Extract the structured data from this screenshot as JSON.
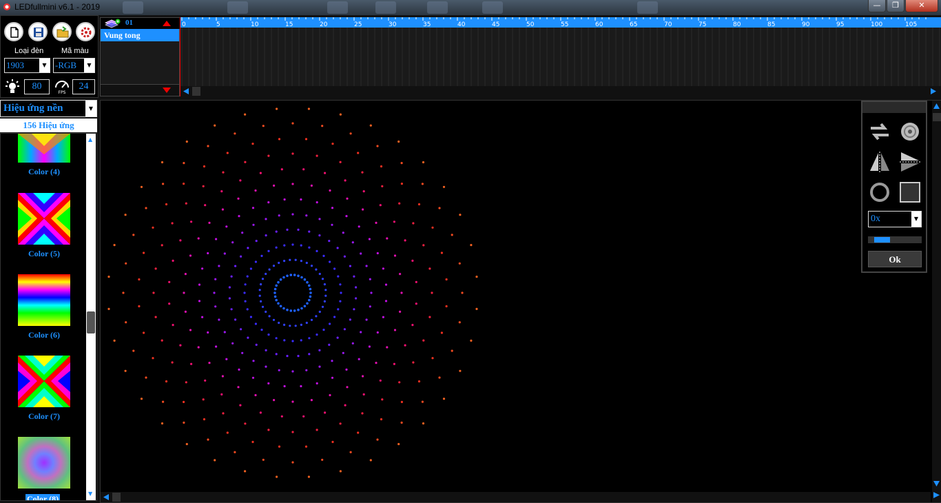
{
  "window": {
    "title": "LEDfullmini v6.1 - 2019",
    "min_glyph": "—",
    "max_glyph": "❐",
    "close_glyph": "✕"
  },
  "toolbar": {
    "buttons": [
      {
        "name": "new-file-button",
        "icon": "new-file-icon"
      },
      {
        "name": "save-button",
        "icon": "save-icon"
      },
      {
        "name": "open-folder-button",
        "icon": "open-folder-icon"
      },
      {
        "name": "settings-button",
        "icon": "gear-icon"
      }
    ],
    "led_type_label": "Loại đèn",
    "color_code_label": "Mã màu",
    "led_type_value": "1903",
    "color_code_value": "-RGB",
    "brightness_value": "80",
    "fps_value": "24"
  },
  "effects": {
    "category": "Hiệu ứng nền",
    "count_label": "156 Hiệu ứng",
    "items": [
      {
        "caption": "Color (4)",
        "pattern": "diamond"
      },
      {
        "caption": "Color (5)",
        "pattern": "x-cross"
      },
      {
        "caption": "Color (6)",
        "pattern": "bands"
      },
      {
        "caption": "Color (7)",
        "pattern": "x-cross"
      },
      {
        "caption": "Color (8)",
        "pattern": "radial",
        "selected": true
      }
    ]
  },
  "layers": {
    "layer_number": "01",
    "items": [
      {
        "name": "Vung tong",
        "selected": true
      }
    ]
  },
  "timeline": {
    "ticks": [
      "0",
      "5",
      "10",
      "15",
      "20",
      "25",
      "30",
      "35",
      "40",
      "45",
      "50",
      "55",
      "60",
      "65",
      "70",
      "75",
      "80",
      "85",
      "90",
      "95",
      "100",
      "105"
    ]
  },
  "tools_panel": {
    "zoom_value": "0x",
    "speed_level": 0.33,
    "ok_label": "Ok",
    "tools": [
      "swap-arrows-icon",
      "rotate-disc-icon",
      "flip-vertical-icon",
      "flip-horizontal-icon",
      "circle-outline-icon",
      "square-outline-icon"
    ]
  },
  "colors": {
    "accent": "#1e90ff",
    "panel_bg": "#000000"
  }
}
